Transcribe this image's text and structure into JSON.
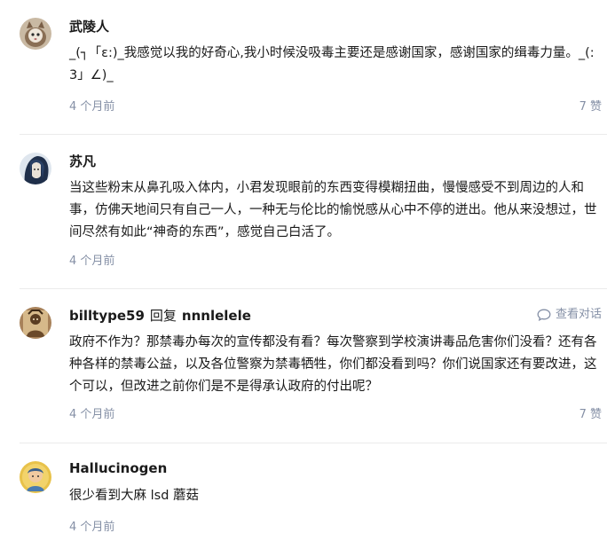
{
  "comments": [
    {
      "author": "武陵人",
      "content": "_(┐「ε:)_我感觉以我的好奇心,我小时候没吸毒主要还是感谢国家，感谢国家的缉毒力量。_(:3」∠)_",
      "time": "4 个月前",
      "likes": "7 赞"
    },
    {
      "author": "苏凡",
      "content": "当这些粉末从鼻孔吸入体内，小君发现眼前的东西变得模糊扭曲，慢慢感受不到周边的人和事，仿佛天地间只有自己一人，一种无与伦比的愉悦感从心中不停的迸出。他从来没想过，世间尽然有如此“神奇的东西”，感觉自己白活了。",
      "time": "4 个月前"
    },
    {
      "author": "billtype59",
      "reply_word": "回复",
      "reply_to": "nnnlelele",
      "view_conversation": "查看对话",
      "content": "政府不作为？那禁毒办每次的宣传都没有看？每次警察到学校演讲毒品危害你们没看？还有各种各样的禁毒公益，以及各位警察为禁毒牺牲，你们都没看到吗？你们说国家还有要改进，这个可以，但改进之前你们是不是得承认政府的付出呢？",
      "time": "4 个月前",
      "likes": "7 赞"
    },
    {
      "author": "Hallucinogen",
      "content": "很少看到大麻 lsd 蘑菇",
      "time": "4 个月前"
    }
  ],
  "colors": {
    "meta": "#8590a6",
    "text": "#1a1a1a",
    "separator": "#ebebeb"
  }
}
